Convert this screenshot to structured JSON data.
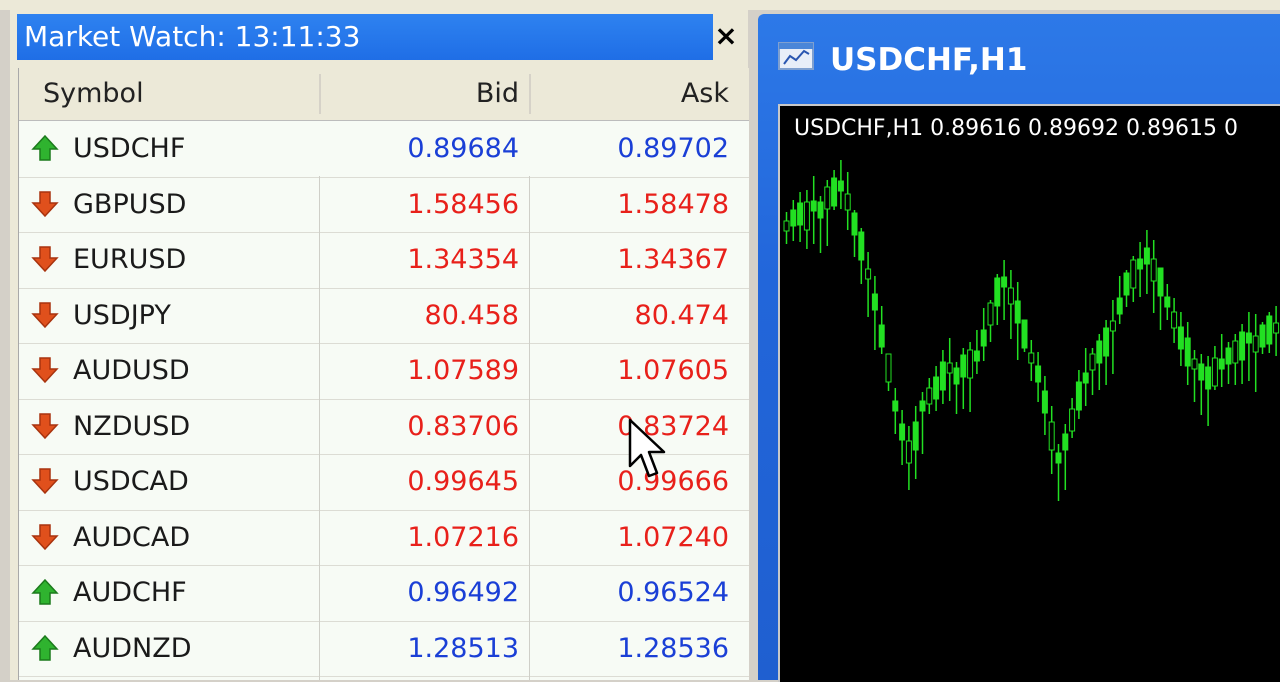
{
  "market_watch": {
    "title": "Market Watch: 13:11:33",
    "close_glyph": "×",
    "columns": {
      "symbol": "Symbol",
      "bid": "Bid",
      "ask": "Ask"
    },
    "rows": [
      {
        "symbol": "USDCHF",
        "bid": "0.89684",
        "ask": "0.89702",
        "direction": "up"
      },
      {
        "symbol": "GBPUSD",
        "bid": "1.58456",
        "ask": "1.58478",
        "direction": "down"
      },
      {
        "symbol": "EURUSD",
        "bid": "1.34354",
        "ask": "1.34367",
        "direction": "down"
      },
      {
        "symbol": "USDJPY",
        "bid": "80.458",
        "ask": "80.474",
        "direction": "down"
      },
      {
        "symbol": "AUDUSD",
        "bid": "1.07589",
        "ask": "1.07605",
        "direction": "down"
      },
      {
        "symbol": "NZDUSD",
        "bid": "0.83706",
        "ask": "0.83724",
        "direction": "down"
      },
      {
        "symbol": "USDCAD",
        "bid": "0.99645",
        "ask": "0.99666",
        "direction": "down"
      },
      {
        "symbol": "AUDCAD",
        "bid": "1.07216",
        "ask": "1.07240",
        "direction": "down"
      },
      {
        "symbol": "AUDCHF",
        "bid": "0.96492",
        "ask": "0.96524",
        "direction": "up"
      },
      {
        "symbol": "AUDNZD",
        "bid": "1.28513",
        "ask": "1.28536",
        "direction": "up"
      }
    ]
  },
  "chart_window": {
    "title": "USDCHF,H1",
    "info": "USDCHF,H1  0.89616 0.89692 0.89615 0"
  },
  "colors": {
    "up": "#1a3fd6",
    "down": "#e8201a",
    "up_arrow": "#2fb32f",
    "down_arrow": "#e0501c",
    "candle": "#22e022"
  }
}
